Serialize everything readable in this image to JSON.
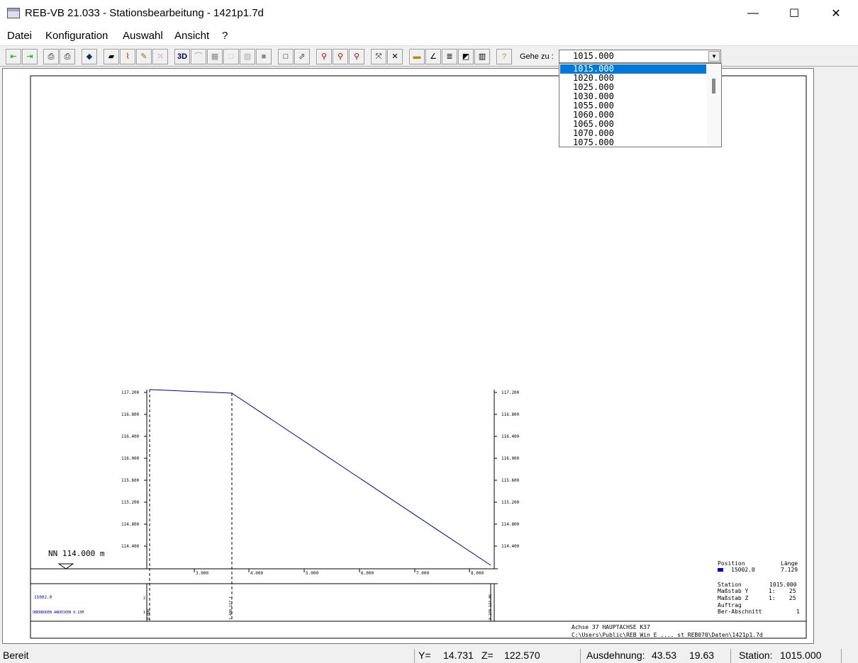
{
  "window": {
    "title": "REB-VB 21.033 - Stationsbearbeitung - 1421p1.7d",
    "minimize": "—",
    "maximize": "☐",
    "close": "✕"
  },
  "menu": {
    "items": [
      "Datei",
      "Konfiguration",
      "Auswahl",
      "Ansicht",
      "?"
    ]
  },
  "toolbar": {
    "goto_label": "Gehe zu :",
    "goto_value": "1015.000",
    "dropdown_options": [
      "1015.000",
      "1020.000",
      "1025.000",
      "1030.000",
      "1055.000",
      "1060.000",
      "1065.000",
      "1070.000",
      "1075.000"
    ],
    "selected_index": 0
  },
  "drawing": {
    "left_scale": [
      "117.200",
      "116.800",
      "116.400",
      "116.000",
      "115.600",
      "115.200",
      "114.800",
      "114.400"
    ],
    "right_scale": [
      "117.200",
      "116.800",
      "116.400",
      "116.000",
      "115.600",
      "115.200",
      "114.800",
      "114.400"
    ],
    "x_ticks": [
      "3.000",
      "4.000",
      "5.000",
      "6.000",
      "7.000",
      "8.000"
    ],
    "nn_label": "NN 114.000 m",
    "row1_label": "15002.0",
    "row2_label": "OBERBODEN ANDECKEN 0.15M",
    "col_marks": [
      "2",
      "1"
    ],
    "vert_label_1": "0.000",
    "vert_label_2": "1.400 117.1",
    "vert_label_3": "8.270 114.06",
    "legend": {
      "position_h": "Position",
      "laenge_h": "Länge",
      "position_val": "15002.0",
      "laenge_val": "7.129",
      "station_label": "Station",
      "station_val": "1015.000",
      "massstab_y_label": "Maßstab Y",
      "massstab_y_val": "1:    25",
      "massstab_z_label": "Maßstab Z",
      "massstab_z_val": "1:    25",
      "auftrag_label": "Auftrag",
      "ber_label": "Ber-Abschnitt",
      "ber_val": "1"
    },
    "footer_line1": "Achse 37 HAUPTACHSE K37",
    "footer_line2": "C:\\Users\\Public\\REB Win E .... st REB070\\Daten\\1421p1.7d",
    "accent": "#0000a0"
  },
  "status": {
    "state": "Bereit",
    "y_label": "Y=",
    "y_val": "14.731",
    "z_label": "Z=",
    "z_val": "122.570",
    "extent_label": "Ausdehnung:",
    "extent_w": "43.53",
    "extent_h": "19.63",
    "station_label": "Station:",
    "station_val": "1015.000"
  }
}
